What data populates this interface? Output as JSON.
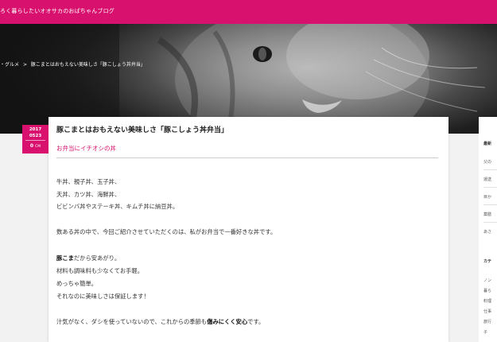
{
  "header": {
    "site_title": "ろく暮らしたいオオサカのおばちゃんブログ"
  },
  "breadcrumb": {
    "items": [
      "・グルメ",
      ">",
      "豚こまとはおもえない美味しさ「豚こしょう丼弁当」"
    ]
  },
  "post": {
    "date_year": "2017",
    "date_month_day": "0523",
    "comment_count": "0",
    "comment_unit": "CM",
    "title": "豚こまとはおもえない美味しさ「豚こしょう丼弁当」",
    "subtitle": "お弁当にイチオシの丼",
    "paragraphs": [
      {
        "line": "牛丼、親子丼、玉子丼、"
      },
      {
        "line": "天丼、カツ丼、海鮮丼、"
      },
      {
        "line": "ビビンバ丼やステーキ丼、キムチ丼に納豆丼。"
      },
      {
        "line": "数ある丼の中で、今回ご紹介させていただくのは、私がお弁当で一番好きな丼です。"
      },
      {
        "bold": "豚こま",
        "rest": "だから安あがり。"
      },
      {
        "line": "材料も調味料も少なくてお手軽。"
      },
      {
        "line": "めっちゃ簡単。"
      },
      {
        "line": "それなのに美味しさは保証します！"
      },
      {
        "pre": "汁気がなく、ダシを使っていないので、これからの季節も",
        "bold": "傷みにくく安心",
        "post": "です。"
      }
    ]
  },
  "sidebar": {
    "heading_new": "最新",
    "new_items": [
      "父の",
      "運送",
      "目か",
      "薬膳",
      "あさ"
    ],
    "heading_category": "カテ",
    "category_items": [
      "ノン",
      "暮ら",
      "料理",
      "仕事",
      "旅行",
      "子"
    ]
  },
  "colors": {
    "accent": "#d8116e"
  }
}
